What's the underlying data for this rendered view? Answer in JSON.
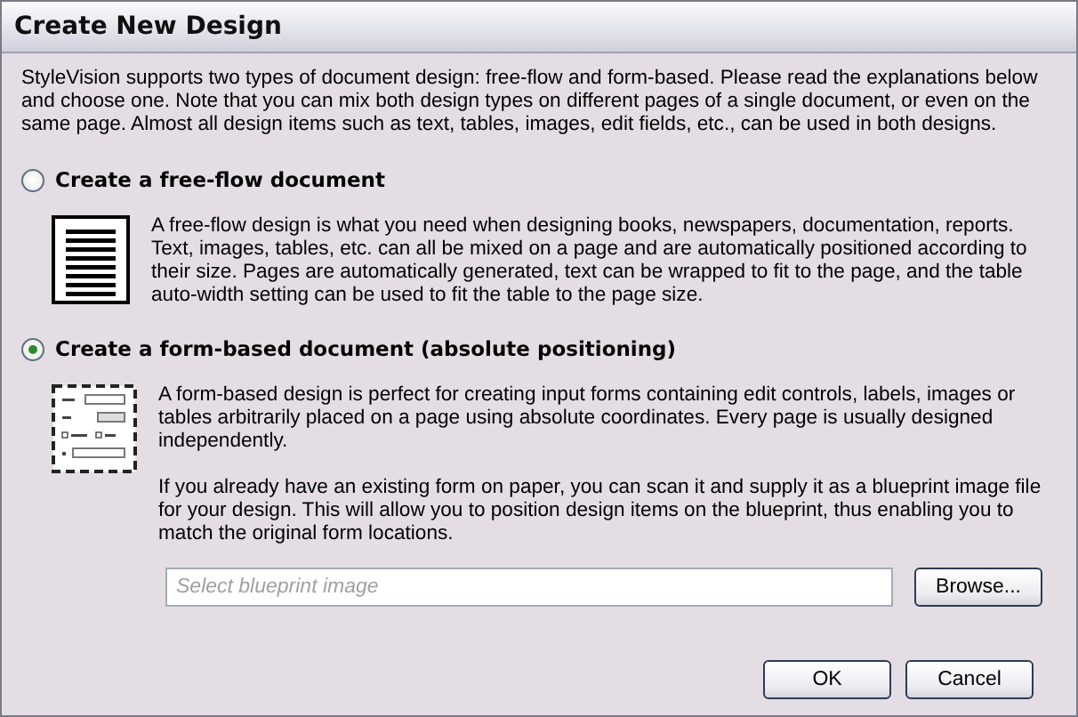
{
  "window": {
    "title": "Create New Design"
  },
  "intro": "StyleVision supports two types of document design: free-flow and form-based. Please read the explanations below and choose one. Note that you can mix both design types on different pages of a single document, or even on the same page. Almost all design items such as text, tables, images, edit fields, etc., can be used in both designs.",
  "options": [
    {
      "kind": "free-flow",
      "label": "Create a free-flow document",
      "selected": false,
      "paragraphs": [
        "A free-flow design is what you need when designing  books, newspapers, documentation, reports. Text, images, tables, etc. can all be mixed on a page and are automatically positioned according to their size. Pages are automatically generated, text can be wrapped to fit to the page, and the table auto-width setting can be used to fit the table to the page size."
      ]
    },
    {
      "kind": "form-based",
      "label": "Create a form-based document (absolute positioning)",
      "selected": true,
      "paragraphs": [
        "A form-based design is perfect for creating input forms containing edit controls, labels, images or tables arbitrarily placed on a page using absolute coordinates. Every page is usually designed independently.",
        "If you already have an existing form on paper, you can scan it and supply it as a blueprint image file for your design. This will allow you to position design items on the blueprint, thus enabling you to match the original form locations."
      ],
      "blueprint": {
        "placeholder": "Select blueprint image",
        "button": "Browse..."
      }
    }
  ],
  "buttons": [
    "OK",
    "Cancel"
  ]
}
